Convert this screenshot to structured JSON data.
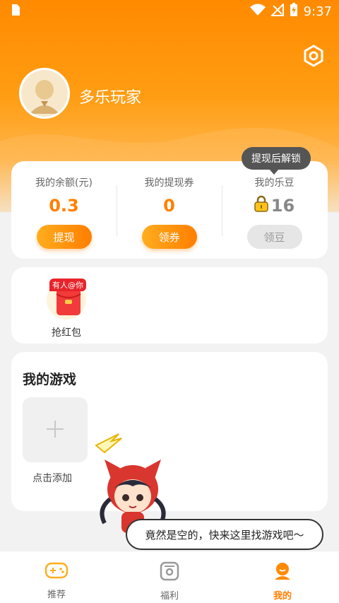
{
  "status": {
    "time": "9:37"
  },
  "profile": {
    "username": "多乐玩家"
  },
  "icons": {
    "settings": "gear-icon",
    "lock": "lock-icon",
    "plus": "plus-icon",
    "redpacket": "red-packet-icon"
  },
  "colors": {
    "accent": "#ff8000",
    "tooltip": "#555555"
  },
  "wallet": {
    "balance": {
      "label": "我的余额(元)",
      "value": "0.3",
      "button": "提现"
    },
    "coupons": {
      "label": "我的提现券",
      "value": "0",
      "button": "领券"
    },
    "beans": {
      "label": "我的乐豆",
      "value": "16",
      "button": "领豆",
      "tooltip": "提现后解锁"
    }
  },
  "redpack": {
    "tag": "有人@你",
    "label": "抢红包"
  },
  "games": {
    "title": "我的游戏",
    "add_label": "点击添加",
    "empty_tip": "竟然是空的，快来这里找游戏吧～"
  },
  "nav": {
    "items": [
      {
        "label": "推荐",
        "icon": "gamepad-icon"
      },
      {
        "label": "福利",
        "icon": "welfare-icon"
      },
      {
        "label": "我的",
        "icon": "profile-icon",
        "active": true
      }
    ]
  }
}
